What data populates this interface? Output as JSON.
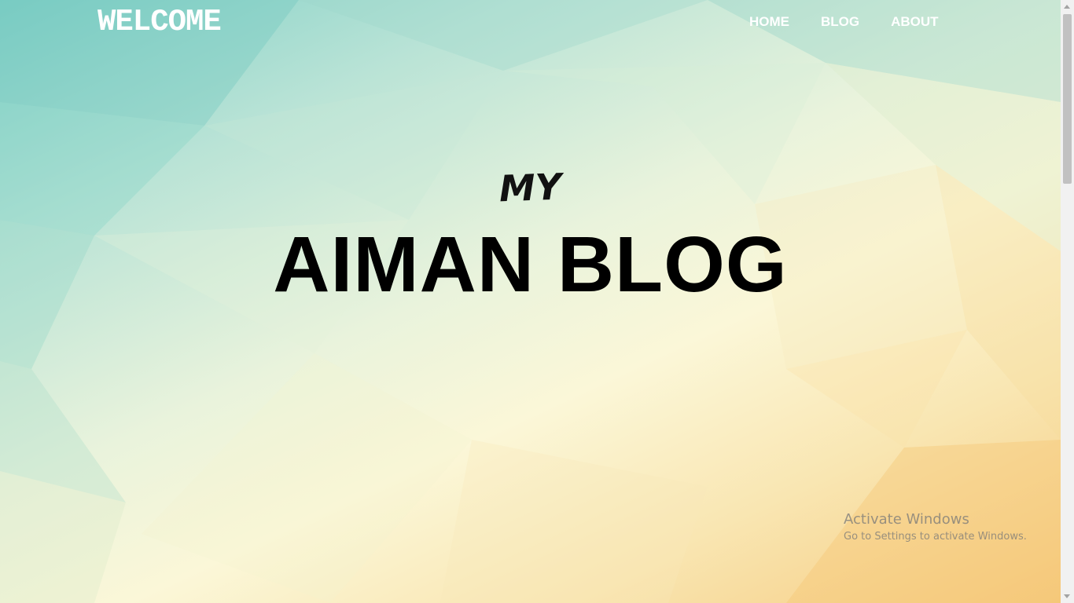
{
  "header": {
    "logo": "WELCOME",
    "nav": [
      {
        "label": "HOME"
      },
      {
        "label": "BLOG"
      },
      {
        "label": "ABOUT"
      }
    ]
  },
  "hero": {
    "pretitle": "MY",
    "title": "AIMAN BLOG"
  },
  "watermark": {
    "title": "Activate Windows",
    "subtitle": "Go to Settings to activate Windows."
  },
  "colors": {
    "nav_text": "#ffffff",
    "title_text": "#000000",
    "bg_teal": "#7fcfc6",
    "bg_cream": "#fbf7d8",
    "bg_orange": "#f6c97c"
  }
}
